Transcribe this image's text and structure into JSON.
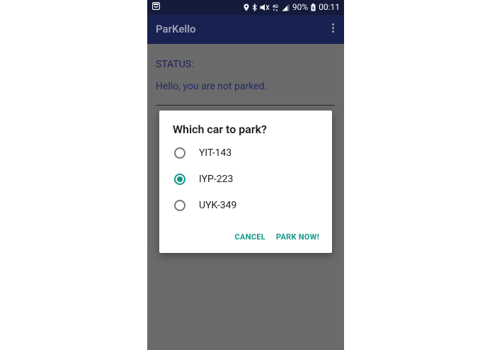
{
  "status_bar": {
    "battery": "90%",
    "time": "00:11",
    "icons": [
      "notification-icon",
      "location-icon",
      "bluetooth-icon",
      "mute-icon",
      "lte-icon",
      "signal-icon",
      "battery-icon"
    ]
  },
  "app_bar": {
    "title": "ParKello",
    "menu_icon": "more-vert-icon"
  },
  "content": {
    "status_label": "STATUS:",
    "status_message": "Hello, you are not parked."
  },
  "dialog": {
    "title": "Which car to park?",
    "options": [
      {
        "label": "YIT-143",
        "checked": false
      },
      {
        "label": "IYP-223",
        "checked": true
      },
      {
        "label": "UYK-349",
        "checked": false
      }
    ],
    "cancel_label": "CANCEL",
    "confirm_label": "PARK NOW!"
  },
  "colors": {
    "accent": "#139a8a",
    "primary": "#192150",
    "status_bar": "#141a3c",
    "scrim": "#6b6b6b"
  }
}
